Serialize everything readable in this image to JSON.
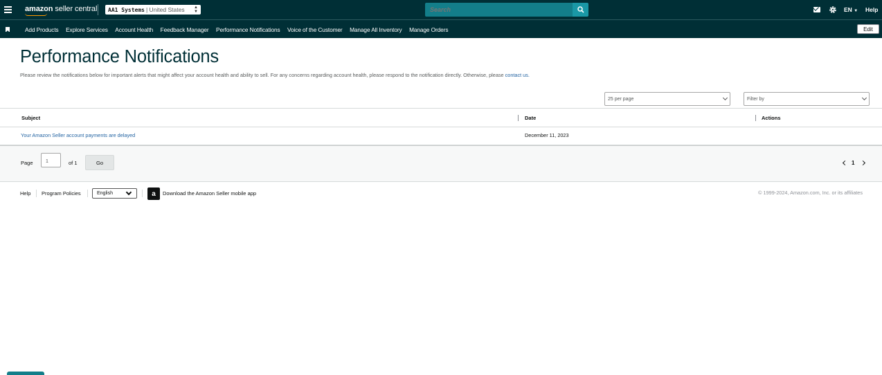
{
  "header": {
    "logo_brand": "amazon",
    "logo_product": "seller central",
    "account_store": "AA1 Systems",
    "account_region": "| United States",
    "search_placeholder": "Search",
    "lang": "EN",
    "help": "Help"
  },
  "nav": {
    "items": [
      {
        "label": "Add Products"
      },
      {
        "label": "Explore Services"
      },
      {
        "label": "Account Health"
      },
      {
        "label": "Feedback Manager"
      },
      {
        "label": "Performance Notifications"
      },
      {
        "label": "Voice of the Customer"
      },
      {
        "label": "Manage All Inventory"
      },
      {
        "label": "Manage Orders"
      }
    ],
    "edit": "Edit"
  },
  "main": {
    "title": "Performance Notifications",
    "intro_text": "Please review the notifications below for important alerts that might affect your account health and ability to sell. For any concerns regarding account health, please respond to the notification directly. Otherwise, please",
    "intro_link": "contact us.",
    "per_page": "25 per page",
    "filter_placeholder": "Filter by"
  },
  "table": {
    "columns": [
      "Subject",
      "Date",
      "Actions"
    ],
    "rows": [
      {
        "subject": "Your Amazon Seller account payments are delayed",
        "date": "December 11, 2023"
      }
    ]
  },
  "pager": {
    "page_label": "Page",
    "page_value": "1",
    "of_label": "of 1",
    "go": "Go",
    "current": "1"
  },
  "footer": {
    "help": "Help",
    "program_policies": "Program Policies",
    "language": "English",
    "app_text": "Download the Amazon Seller mobile app",
    "copyright": "© 1999-2024, Amazon.com, Inc. or its affiliates"
  },
  "colors": {
    "header_bg": "#002f36",
    "search_bg": "#137e8a",
    "link": "#2162a1"
  }
}
